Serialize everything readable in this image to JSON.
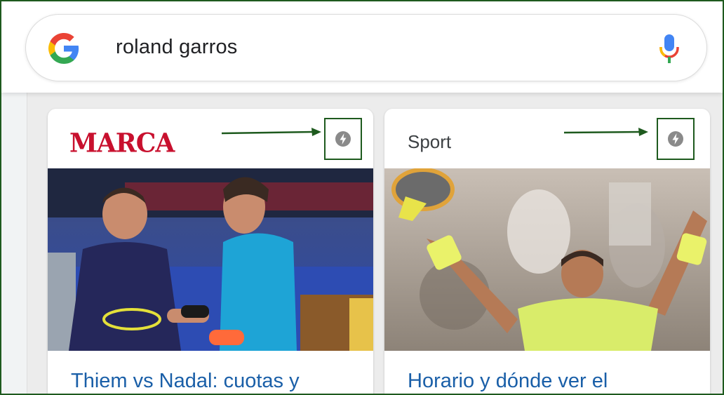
{
  "search": {
    "query": "roland garros"
  },
  "cards": [
    {
      "source": "MARCA",
      "headline": "Thiem vs Nadal: cuotas y"
    },
    {
      "source": "Sport",
      "headline": "Horario y dónde ver el"
    }
  ],
  "icons": {
    "google": "google-g-icon",
    "mic": "microphone-icon",
    "amp": "amp-lightning-icon",
    "arrow": "arrow-right-annotation"
  },
  "colors": {
    "link": "#1a5fa8",
    "marca_red": "#c8102e",
    "annotation_green": "#1e5a1e",
    "amp_grey": "#8a8a8a"
  }
}
